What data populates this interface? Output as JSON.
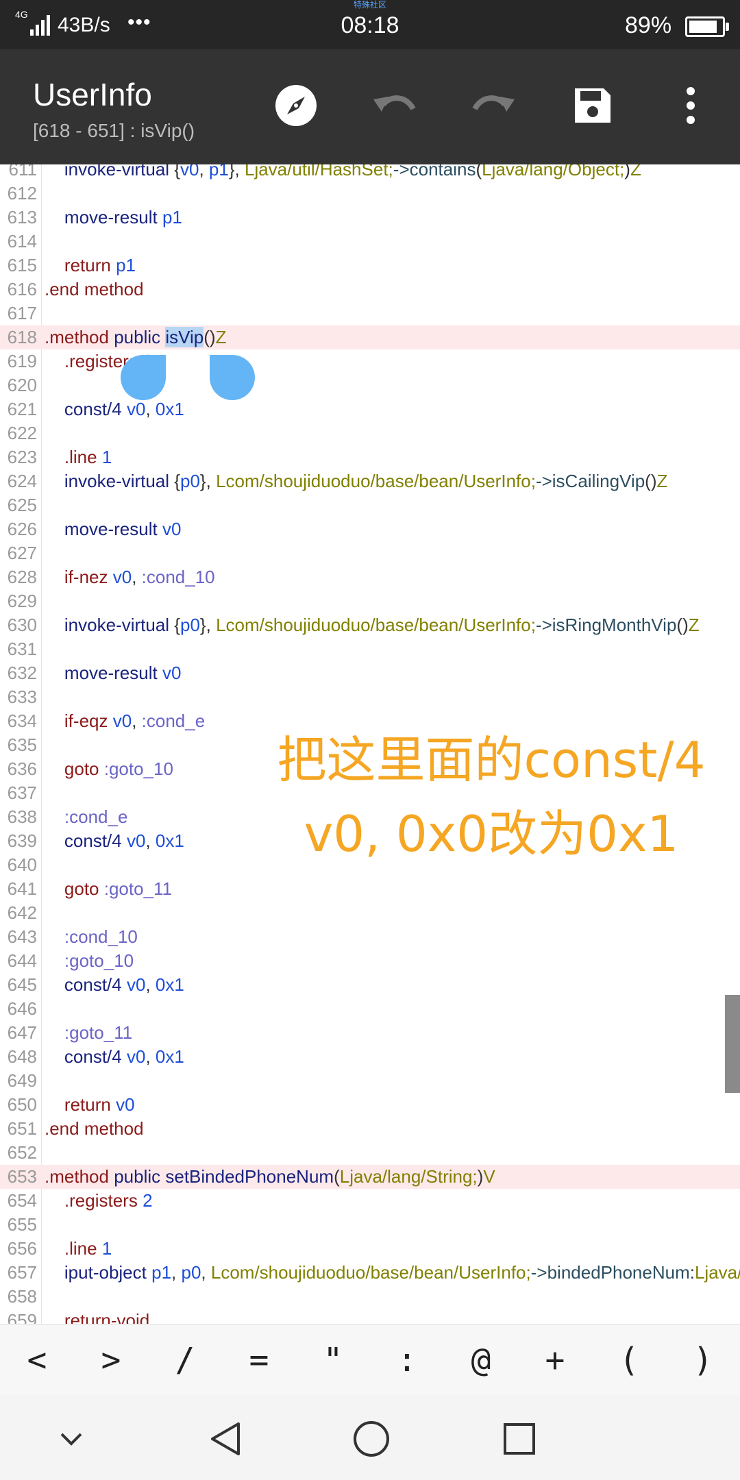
{
  "status_bar": {
    "network": "4G",
    "speed": "43B/s",
    "dots": "•••",
    "brand": "特殊社区",
    "time": "08:18",
    "battery_text": "89%"
  },
  "app_bar": {
    "title": "UserInfo",
    "subtitle": "[618 - 651] : isVip()",
    "actions": [
      "compass-icon",
      "undo-icon",
      "redo-icon",
      "save-icon",
      "more-vert-icon"
    ]
  },
  "editor": {
    "lines": [
      {
        "n": "611",
        "tokens": [
          [
            "    ",
            ""
          ],
          [
            "invoke-virtual",
            "kw"
          ],
          [
            " {",
            "punc"
          ],
          [
            "v0",
            "reg"
          ],
          [
            ", ",
            "punc"
          ],
          [
            "p1",
            "reg"
          ],
          [
            "}, ",
            "punc"
          ],
          [
            "Ljava/util/HashSet;",
            "cls"
          ],
          [
            "->",
            "mem"
          ],
          [
            "contains",
            "mem"
          ],
          [
            "(",
            "punc"
          ],
          [
            "Ljava/lang/Object;",
            "cls"
          ],
          [
            ")",
            "punc"
          ],
          [
            "Z",
            "cls"
          ]
        ]
      },
      {
        "n": "612",
        "tokens": []
      },
      {
        "n": "613",
        "tokens": [
          [
            "    ",
            ""
          ],
          [
            "move-result",
            "kw"
          ],
          [
            " ",
            "punc"
          ],
          [
            "p1",
            "reg"
          ]
        ]
      },
      {
        "n": "614",
        "tokens": []
      },
      {
        "n": "615",
        "tokens": [
          [
            "    ",
            ""
          ],
          [
            "return",
            "dir"
          ],
          [
            " ",
            "punc"
          ],
          [
            "p1",
            "reg"
          ]
        ]
      },
      {
        "n": "616",
        "tokens": [
          [
            ".end",
            "dir"
          ],
          [
            " ",
            "punc"
          ],
          [
            "method",
            "dir"
          ]
        ]
      },
      {
        "n": "617",
        "tokens": []
      },
      {
        "n": "618",
        "hl": true,
        "tokens": [
          [
            ".method",
            "dir"
          ],
          [
            " ",
            "punc"
          ],
          [
            "public",
            "kw"
          ],
          [
            " ",
            "punc"
          ],
          [
            "isVip",
            "kw",
            "sel"
          ],
          [
            "()",
            "punc"
          ],
          [
            "Z",
            "cls"
          ]
        ]
      },
      {
        "n": "619",
        "tokens": [
          [
            "    ",
            ""
          ],
          [
            ".registers",
            "dir"
          ],
          [
            " ",
            "punc"
          ],
          [
            "2",
            "reg"
          ]
        ]
      },
      {
        "n": "620",
        "tokens": []
      },
      {
        "n": "621",
        "tokens": [
          [
            "    ",
            ""
          ],
          [
            "const/4",
            "kw"
          ],
          [
            " ",
            "punc"
          ],
          [
            "v0",
            "reg"
          ],
          [
            ", ",
            "punc"
          ],
          [
            "0x1",
            "reg"
          ]
        ]
      },
      {
        "n": "622",
        "tokens": []
      },
      {
        "n": "623",
        "tokens": [
          [
            "    ",
            ""
          ],
          [
            ".line",
            "dir"
          ],
          [
            " ",
            "punc"
          ],
          [
            "1",
            "reg"
          ]
        ]
      },
      {
        "n": "624",
        "tokens": [
          [
            "    ",
            ""
          ],
          [
            "invoke-virtual",
            "kw"
          ],
          [
            " {",
            "punc"
          ],
          [
            "p0",
            "reg"
          ],
          [
            "}, ",
            "punc"
          ],
          [
            "Lcom/shoujiduoduo/base/bean/UserInfo;",
            "cls"
          ],
          [
            "->",
            "mem"
          ],
          [
            "isCailingVip",
            "mem"
          ],
          [
            "()",
            "punc"
          ],
          [
            "Z",
            "cls"
          ]
        ]
      },
      {
        "n": "625",
        "tokens": []
      },
      {
        "n": "626",
        "tokens": [
          [
            "    ",
            ""
          ],
          [
            "move-result",
            "kw"
          ],
          [
            " ",
            "punc"
          ],
          [
            "v0",
            "reg"
          ]
        ]
      },
      {
        "n": "627",
        "tokens": []
      },
      {
        "n": "628",
        "tokens": [
          [
            "    ",
            ""
          ],
          [
            "if-nez",
            "dir"
          ],
          [
            " ",
            "punc"
          ],
          [
            "v0",
            "reg"
          ],
          [
            ", ",
            "punc"
          ],
          [
            ":cond_10",
            "lbl"
          ]
        ]
      },
      {
        "n": "629",
        "tokens": []
      },
      {
        "n": "630",
        "tokens": [
          [
            "    ",
            ""
          ],
          [
            "invoke-virtual",
            "kw"
          ],
          [
            " {",
            "punc"
          ],
          [
            "p0",
            "reg"
          ],
          [
            "}, ",
            "punc"
          ],
          [
            "Lcom/shoujiduoduo/base/bean/UserInfo;",
            "cls"
          ],
          [
            "->",
            "mem"
          ],
          [
            "isRingMonthVip",
            "mem"
          ],
          [
            "()",
            "punc"
          ],
          [
            "Z",
            "cls"
          ]
        ]
      },
      {
        "n": "631",
        "tokens": []
      },
      {
        "n": "632",
        "tokens": [
          [
            "    ",
            ""
          ],
          [
            "move-result",
            "kw"
          ],
          [
            " ",
            "punc"
          ],
          [
            "v0",
            "reg"
          ]
        ]
      },
      {
        "n": "633",
        "tokens": []
      },
      {
        "n": "634",
        "tokens": [
          [
            "    ",
            ""
          ],
          [
            "if-eqz",
            "dir"
          ],
          [
            " ",
            "punc"
          ],
          [
            "v0",
            "reg"
          ],
          [
            ", ",
            "punc"
          ],
          [
            ":cond_e",
            "lbl"
          ]
        ]
      },
      {
        "n": "635",
        "tokens": []
      },
      {
        "n": "636",
        "tokens": [
          [
            "    ",
            ""
          ],
          [
            "goto",
            "dir"
          ],
          [
            " ",
            "punc"
          ],
          [
            ":goto_10",
            "lbl"
          ]
        ]
      },
      {
        "n": "637",
        "tokens": []
      },
      {
        "n": "638",
        "tokens": [
          [
            "    ",
            ""
          ],
          [
            ":cond_e",
            "lbl"
          ]
        ]
      },
      {
        "n": "639",
        "tokens": [
          [
            "    ",
            ""
          ],
          [
            "const/4",
            "kw"
          ],
          [
            " ",
            "punc"
          ],
          [
            "v0",
            "reg"
          ],
          [
            ", ",
            "punc"
          ],
          [
            "0x1",
            "reg"
          ]
        ]
      },
      {
        "n": "640",
        "tokens": []
      },
      {
        "n": "641",
        "tokens": [
          [
            "    ",
            ""
          ],
          [
            "goto",
            "dir"
          ],
          [
            " ",
            "punc"
          ],
          [
            ":goto_11",
            "lbl"
          ]
        ]
      },
      {
        "n": "642",
        "tokens": []
      },
      {
        "n": "643",
        "tokens": [
          [
            "    ",
            ""
          ],
          [
            ":cond_10",
            "lbl"
          ]
        ]
      },
      {
        "n": "644",
        "tokens": [
          [
            "    ",
            ""
          ],
          [
            ":goto_10",
            "lbl"
          ]
        ]
      },
      {
        "n": "645",
        "tokens": [
          [
            "    ",
            ""
          ],
          [
            "const/4",
            "kw"
          ],
          [
            " ",
            "punc"
          ],
          [
            "v0",
            "reg"
          ],
          [
            ", ",
            "punc"
          ],
          [
            "0x1",
            "reg"
          ]
        ]
      },
      {
        "n": "646",
        "tokens": []
      },
      {
        "n": "647",
        "tokens": [
          [
            "    ",
            ""
          ],
          [
            ":goto_11",
            "lbl"
          ]
        ]
      },
      {
        "n": "648",
        "tokens": [
          [
            "    ",
            ""
          ],
          [
            "const/4",
            "kw"
          ],
          [
            " ",
            "punc"
          ],
          [
            "v0",
            "reg"
          ],
          [
            ", ",
            "punc"
          ],
          [
            "0x1",
            "reg"
          ]
        ]
      },
      {
        "n": "649",
        "tokens": []
      },
      {
        "n": "650",
        "tokens": [
          [
            "    ",
            ""
          ],
          [
            "return",
            "dir"
          ],
          [
            " ",
            "punc"
          ],
          [
            "v0",
            "reg"
          ]
        ]
      },
      {
        "n": "651",
        "tokens": [
          [
            ".end",
            "dir"
          ],
          [
            " ",
            "punc"
          ],
          [
            "method",
            "dir"
          ]
        ]
      },
      {
        "n": "652",
        "tokens": []
      },
      {
        "n": "653",
        "hl": true,
        "tokens": [
          [
            ".method",
            "dir"
          ],
          [
            " ",
            "punc"
          ],
          [
            "public",
            "kw"
          ],
          [
            " ",
            "punc"
          ],
          [
            "setBindedPhoneNum",
            "kw"
          ],
          [
            "(",
            "punc"
          ],
          [
            "Ljava/lang/String;",
            "cls"
          ],
          [
            ")",
            "punc"
          ],
          [
            "V",
            "cls"
          ]
        ]
      },
      {
        "n": "654",
        "tokens": [
          [
            "    ",
            ""
          ],
          [
            ".registers",
            "dir"
          ],
          [
            " ",
            "punc"
          ],
          [
            "2",
            "reg"
          ]
        ]
      },
      {
        "n": "655",
        "tokens": []
      },
      {
        "n": "656",
        "tokens": [
          [
            "    ",
            ""
          ],
          [
            ".line",
            "dir"
          ],
          [
            " ",
            "punc"
          ],
          [
            "1",
            "reg"
          ]
        ]
      },
      {
        "n": "657",
        "tokens": [
          [
            "    ",
            ""
          ],
          [
            "iput-object",
            "kw"
          ],
          [
            " ",
            "punc"
          ],
          [
            "p1",
            "reg"
          ],
          [
            ", ",
            "punc"
          ],
          [
            "p0",
            "reg"
          ],
          [
            ", ",
            "punc"
          ],
          [
            "Lcom/shoujiduoduo/base/bean/UserInfo;",
            "cls"
          ],
          [
            "->",
            "mem"
          ],
          [
            "bindedPhoneNum",
            "mem"
          ],
          [
            ":",
            "punc"
          ],
          [
            "Ljava/lang/String;",
            "cls"
          ]
        ]
      },
      {
        "n": "658",
        "tokens": []
      },
      {
        "n": "659",
        "tokens": [
          [
            "    ",
            ""
          ],
          [
            "return-void",
            "dir"
          ]
        ]
      }
    ]
  },
  "overlay_text": {
    "line1": "把这里面的const/4",
    "line2": "v0, 0x0改为0x1"
  },
  "symbol_bar": [
    "<",
    ">",
    "/",
    "=",
    "\"",
    ":",
    "@",
    "+",
    "(",
    ")"
  ],
  "nav_bar": [
    "chevron-down-icon",
    "back-triangle-icon",
    "home-circle-icon",
    "recents-square-icon"
  ],
  "colors": {
    "status_bar_bg": "#262626",
    "app_bar_bg": "#333333",
    "highlight_line": "#fde9ea",
    "selection": "#b7d6f4",
    "handle": "#64b5f6",
    "overlay_text": "#f5a623"
  }
}
